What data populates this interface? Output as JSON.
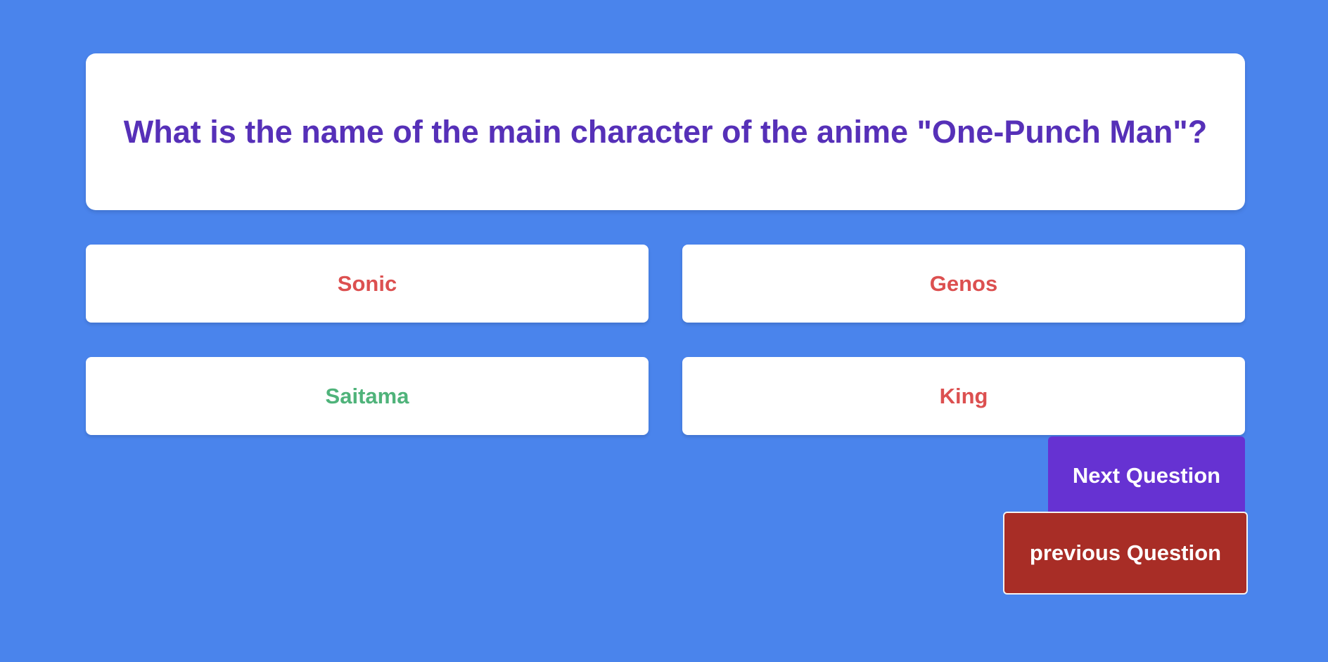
{
  "quiz": {
    "question": "What is the name of the main character of the anime \"One-Punch Man\"?",
    "answers": [
      {
        "label": "Sonic",
        "status": "wrong",
        "color": "#dc5050"
      },
      {
        "label": "Genos",
        "status": "wrong",
        "color": "#dc5050"
      },
      {
        "label": "Saitama",
        "status": "correct",
        "color": "#4fb37a"
      },
      {
        "label": "King",
        "status": "wrong",
        "color": "#dc5050"
      }
    ]
  },
  "navigation": {
    "next_label": "Next Question",
    "previous_label": "previous Question"
  },
  "colors": {
    "background": "#4a84ec",
    "question_text": "#5630b8",
    "next_button": "#6632d2",
    "previous_button": "#a82d26"
  }
}
